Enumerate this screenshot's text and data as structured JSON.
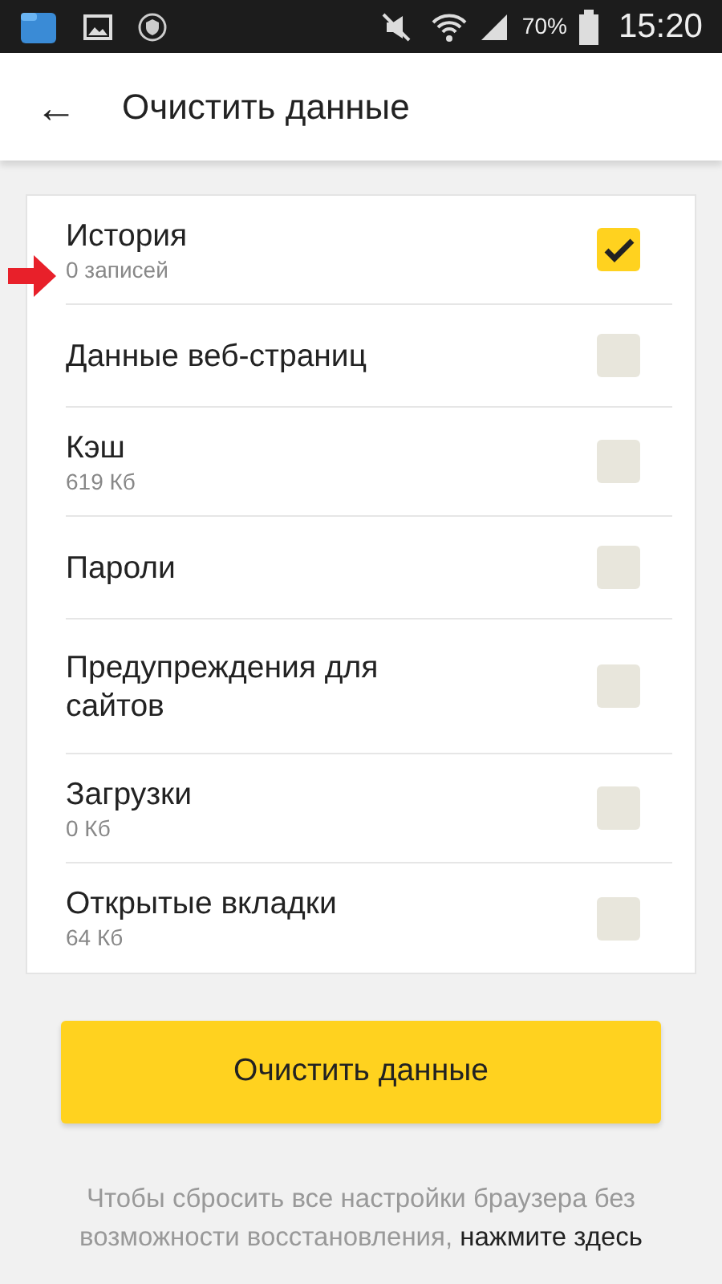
{
  "status_bar": {
    "battery": "70%",
    "time": "15:20"
  },
  "app_bar": {
    "back_icon": "←",
    "title": "Очистить данные"
  },
  "items": [
    {
      "label": "История",
      "detail": "0 записей",
      "checked": true,
      "marked": true
    },
    {
      "label": "Данные веб-страниц",
      "checked": false
    },
    {
      "label": "Кэш",
      "detail": "619 Кб",
      "checked": false
    },
    {
      "label": "Пароли",
      "checked": false
    },
    {
      "label": "Предупреждения для сайтов",
      "checked": false
    },
    {
      "label": "Загрузки",
      "detail": "0 Кб",
      "checked": false
    },
    {
      "label": "Открытые вкладки",
      "detail": "64 Кб",
      "checked": false
    }
  ],
  "clear_button": "Очистить данные",
  "footer": {
    "text": "Чтобы сбросить все настройки браузера без возможности восстановления,",
    "link": "нажмите здесь"
  }
}
